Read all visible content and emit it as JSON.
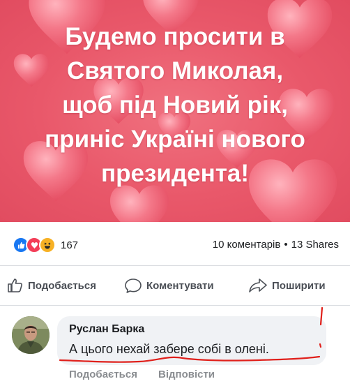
{
  "post": {
    "headline_lines": [
      "Будемо просити в",
      "Святого Миколая,",
      "щоб під Новий рік,",
      "приніс Україні нового",
      "президента!"
    ],
    "colors": {
      "background": "#e9586a",
      "heart": "#f27c8c",
      "text": "#ffffff"
    }
  },
  "stats": {
    "reactions": [
      "like-icon",
      "love-icon",
      "haha-icon"
    ],
    "reaction_count": "167",
    "comments": "10 коментарів",
    "separator": "•",
    "shares": "13 Shares"
  },
  "actions": {
    "like": "Подобається",
    "comment": "Коментувати",
    "share": "Поширити"
  },
  "comment": {
    "author": "Руслан Барка",
    "text": "А цього нехай забере собі в олені.",
    "like": "Подобається",
    "reply": "Відповісти",
    "annotation_color": "#e0201b"
  }
}
